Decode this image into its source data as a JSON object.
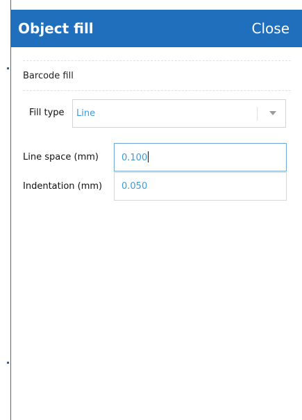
{
  "header": {
    "title": "Object fill",
    "close_label": "Close"
  },
  "barcode_fill": {
    "section_title": "Barcode fill",
    "fill_type": {
      "label": "Fill type",
      "value": "Line"
    },
    "line_space": {
      "label": "Line space (mm)",
      "value": "0.100"
    },
    "indentation": {
      "label": "Indentation (mm)",
      "value": "0.050"
    }
  },
  "colors": {
    "header_bg": "#1f6fbd",
    "accent_text": "#3a9bd9",
    "focus_border": "#6aa6d8"
  },
  "icons": {
    "dropdown": "chevron-down-icon"
  }
}
